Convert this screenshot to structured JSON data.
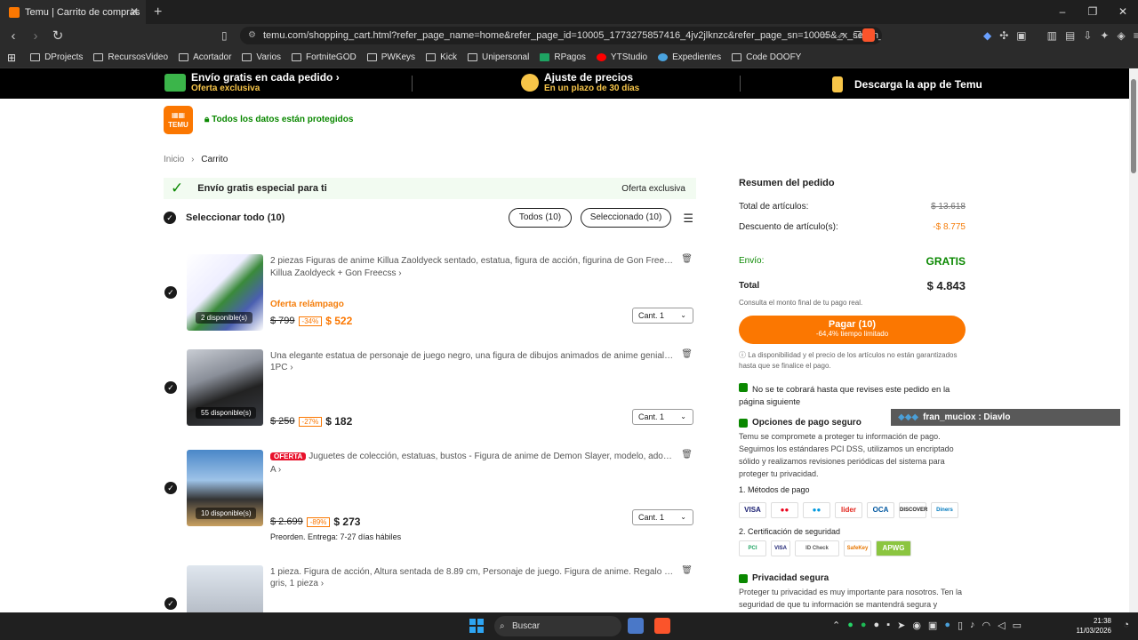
{
  "browser": {
    "tab_title": "Temu | Carrito de compras",
    "tab_close": "✕",
    "new_tab": "+",
    "url": "temu.com/shopping_cart.html?refer_page_name=home&refer_page_id=10005_1773275857416_4jv2jlknzc&refer_page_sn=10005&_x_sessn_id=vonp...",
    "bookmarks": [
      "DProjects",
      "RecursosVideo",
      "Acortador",
      "Varios",
      "FortniteGOD",
      "PWKeys",
      "Kick",
      "Unipersonal",
      "RPagos",
      "YTStudio",
      "Expedientes",
      "Code DOOFY"
    ]
  },
  "promo": {
    "shipping_title": "Envío gratis en cada pedido",
    "shipping_sub": "Oferta exclusiva",
    "price_title": "Ajuste de precios",
    "price_sub": "En un plazo de 30 días",
    "app": "Descarga la app de Temu"
  },
  "header": {
    "logo": "TEMU",
    "safe": "Todos los datos están protegidos",
    "crumb_home": "Inicio",
    "crumb_sep": "›",
    "crumb_current": "Carrito"
  },
  "cart": {
    "free_title": "Envío gratis especial para ti",
    "free_right": "Oferta exclusiva",
    "select_all": "Seleccionar todo (10)",
    "pill_all": "Todos (10)",
    "pill_selected": "Seleccionado (10)",
    "items": [
      {
        "title": "2 piezas Figuras de anime Killua Zaoldyeck sentado, estatua, figura de acción, figurina de Gon Freecss, adorno de escritorio",
        "variant": "Killua Zaoldyeck + Gon Freecss ›",
        "stock": "2 disponible(s)",
        "flash": "Oferta relámpago",
        "old": "$ 799",
        "disc": "-34%",
        "now": "$ 522",
        "qty": "Cant. 1"
      },
      {
        "title": "Una elegante estatua de personaje de juego negro, una figura de dibujos animados de anime genial en pose",
        "variant": "1PC ›",
        "stock": "55 disponible(s)",
        "old": "$ 250",
        "disc": "-27%",
        "now": "$ 182",
        "qty": "Cant. 1"
      },
      {
        "badge": "OFERTA",
        "title": "Juguetes de colección, estatuas, bustos - Figura de anime de Demon Slayer, modelo, adorno de colección",
        "variant": "A ›",
        "stock": "10 disponible(s)",
        "old": "$ 2.699",
        "disc": "-89%",
        "now": "$ 273",
        "qty": "Cant. 1",
        "eta": "Preorden. Entrega: 7-27 días hábiles"
      },
      {
        "title": "1 pieza. Figura de acción, Altura sentada de 8.89 cm, Personaje de juego. Figura de anime. Regalo de Navidad",
        "variant": "gris, 1 pieza ›"
      }
    ]
  },
  "summary": {
    "title": "Resumen del pedido",
    "items_label": "Total de artículos:",
    "items_value": "$ 13.618",
    "discount_label": "Descuento de artículo(s):",
    "discount_value": "-$ 8.775",
    "shipping_label": "Envío:",
    "shipping_value": "GRATIS",
    "total_label": "Total",
    "total_value": "$ 4.843",
    "note": "Consulta el monto final de tu pago real.",
    "pay_label": "Pagar (10)",
    "pay_sub": "-64,4% tiempo limitado",
    "disclaimer": "La disponibilidad y el precio de los artículos no están garantizados hasta que se finalice el pago.",
    "no_charge": "No se te cobrará hasta que revises este pedido en la página siguiente",
    "secure_title": "Opciones de pago seguro",
    "secure_green": "Temu se compromete a proteger tu información de pago.",
    "secure_text": "Seguimos los estándares PCI DSS, utilizamos un encriptado sólido y realizamos revisiones periódicas del sistema para proteger tu privacidad.",
    "methods_title": "1. Métodos de pago",
    "methods": [
      "VISA",
      "MC",
      "Maestro",
      "lider",
      "OCA",
      "DISCOVER",
      "Diners"
    ],
    "cert_title": "2. Certificación de seguridad",
    "certs": [
      "PCI",
      "VISA",
      "ID Check",
      "SafeKey",
      "APWG"
    ],
    "privacy_title": "Privacidad segura",
    "privacy_text": "Proteger tu privacidad es muy importante para nosotros. Ten la seguridad de que tu información se mantendrá segura y"
  },
  "overlay": {
    "user": "fran_muciox",
    "message": ": Diavlo"
  },
  "taskbar": {
    "search": "Buscar",
    "time": "21:38",
    "date": "11/03/2026"
  },
  "colors": {
    "temu_orange": "#fb7701",
    "green": "#0a8800",
    "promo_yellow": "#f7c548"
  }
}
